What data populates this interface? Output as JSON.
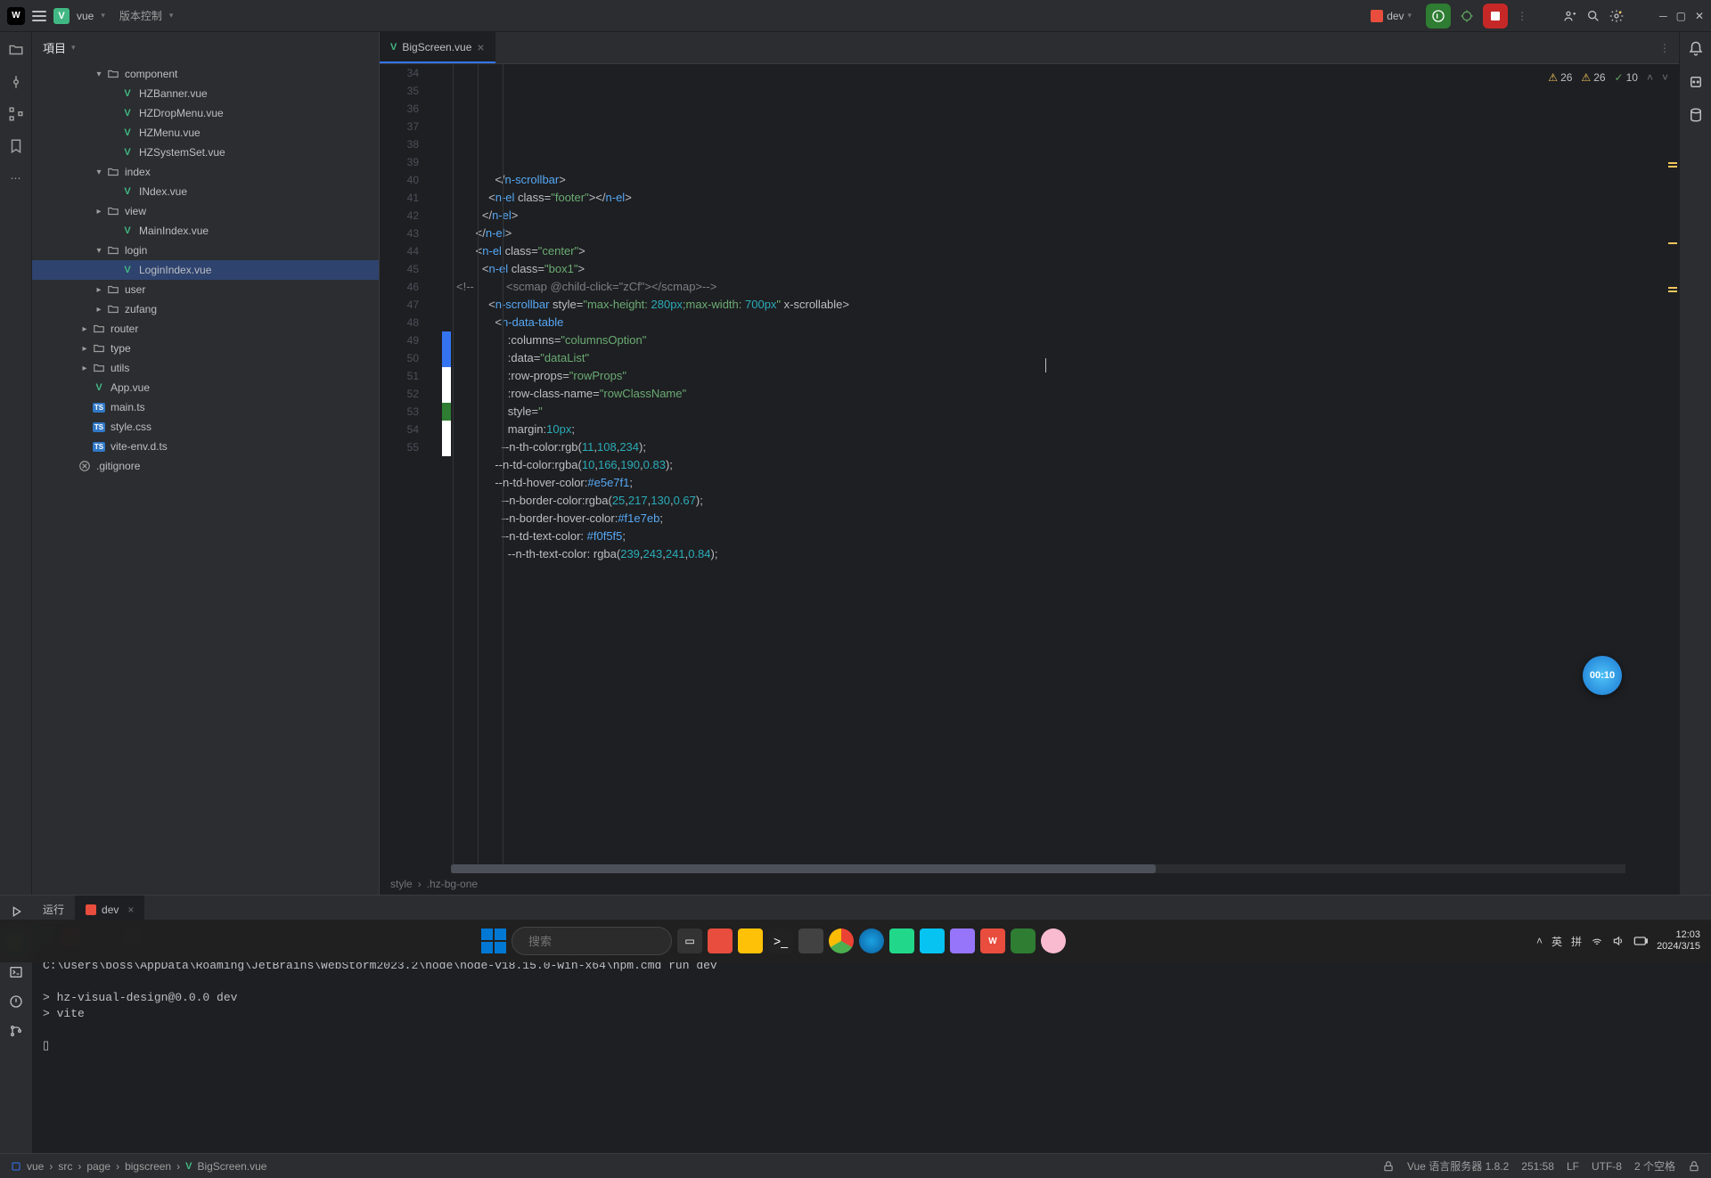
{
  "titlebar": {
    "project": "vue",
    "vcMenu": "版本控制",
    "runConfig": "dev"
  },
  "projectPanel": {
    "title": "項目"
  },
  "tree": [
    {
      "depth": 3,
      "arrow": "▾",
      "icon": "folder",
      "label": "component"
    },
    {
      "depth": 4,
      "arrow": "",
      "icon": "vue",
      "label": "HZBanner.vue"
    },
    {
      "depth": 4,
      "arrow": "",
      "icon": "vue",
      "label": "HZDropMenu.vue"
    },
    {
      "depth": 4,
      "arrow": "",
      "icon": "vue",
      "label": "HZMenu.vue"
    },
    {
      "depth": 4,
      "arrow": "",
      "icon": "vue",
      "label": "HZSystemSet.vue"
    },
    {
      "depth": 3,
      "arrow": "▾",
      "icon": "folder",
      "label": "index"
    },
    {
      "depth": 4,
      "arrow": "",
      "icon": "vue",
      "label": "INdex.vue"
    },
    {
      "depth": 3,
      "arrow": "▸",
      "icon": "folder",
      "label": "view"
    },
    {
      "depth": 4,
      "arrow": "",
      "icon": "vue",
      "label": "MainIndex.vue"
    },
    {
      "depth": 3,
      "arrow": "▾",
      "icon": "folder",
      "label": "login"
    },
    {
      "depth": 4,
      "arrow": "",
      "icon": "vue",
      "label": "LoginIndex.vue",
      "selected": true
    },
    {
      "depth": 3,
      "arrow": "▸",
      "icon": "folder",
      "label": "user"
    },
    {
      "depth": 3,
      "arrow": "▸",
      "icon": "folder",
      "label": "zufang"
    },
    {
      "depth": 2,
      "arrow": "▸",
      "icon": "folder",
      "label": "router"
    },
    {
      "depth": 2,
      "arrow": "▸",
      "icon": "folder",
      "label": "type"
    },
    {
      "depth": 2,
      "arrow": "▸",
      "icon": "folder",
      "label": "utils"
    },
    {
      "depth": 2,
      "arrow": "",
      "icon": "vue",
      "label": "App.vue"
    },
    {
      "depth": 2,
      "arrow": "",
      "icon": "ts",
      "label": "main.ts"
    },
    {
      "depth": 2,
      "arrow": "",
      "icon": "ts",
      "label": "style.css"
    },
    {
      "depth": 2,
      "arrow": "",
      "icon": "ts",
      "label": "vite-env.d.ts"
    },
    {
      "depth": 1,
      "arrow": "",
      "icon": "ignore",
      "label": ".gitignore"
    }
  ],
  "tab": {
    "label": "BigScreen.vue"
  },
  "problems": {
    "err": "26",
    "warn": "26",
    "typo": "10"
  },
  "lineStart": 34,
  "markers": {
    "49": "#3574f0",
    "50": "#3574f0",
    "51": "#ffffff",
    "52": "#ffffff",
    "53": "#2e7d32",
    "54": "#ffffff",
    "55": "#ffffff"
  },
  "code": [
    [
      {
        "t": "            </",
        "c": "c-punct"
      },
      {
        "t": "n-scrollbar",
        "c": "c-tag"
      },
      {
        "t": ">",
        "c": "c-punct"
      }
    ],
    [
      {
        "t": "          <",
        "c": "c-punct"
      },
      {
        "t": "n-el",
        "c": "c-tag"
      },
      {
        "t": " class",
        "c": "c-attr"
      },
      {
        "t": "=",
        "c": "c-punct"
      },
      {
        "t": "\"footer\"",
        "c": "c-str"
      },
      {
        "t": "></",
        "c": "c-punct"
      },
      {
        "t": "n-el",
        "c": "c-tag"
      },
      {
        "t": ">",
        "c": "c-punct"
      }
    ],
    [
      {
        "t": "        </",
        "c": "c-punct"
      },
      {
        "t": "n-el",
        "c": "c-tag"
      },
      {
        "t": ">",
        "c": "c-punct"
      }
    ],
    [
      {
        "t": "      </",
        "c": "c-punct"
      },
      {
        "t": "n-el",
        "c": "c-tag"
      },
      {
        "t": ">",
        "c": "c-punct"
      }
    ],
    [
      {
        "t": "      <",
        "c": "c-punct"
      },
      {
        "t": "n-el",
        "c": "c-tag"
      },
      {
        "t": " class",
        "c": "c-attr"
      },
      {
        "t": "=",
        "c": "c-punct"
      },
      {
        "t": "\"center\"",
        "c": "c-str"
      },
      {
        "t": ">",
        "c": "c-punct"
      }
    ],
    [
      {
        "t": "        <",
        "c": "c-punct"
      },
      {
        "t": "n-el",
        "c": "c-tag"
      },
      {
        "t": " class",
        "c": "c-attr"
      },
      {
        "t": "=",
        "c": "c-punct"
      },
      {
        "t": "\"box1\"",
        "c": "c-str"
      },
      {
        "t": ">",
        "c": "c-punct"
      }
    ],
    [
      {
        "t": "<!--",
        "c": "c-cmt"
      },
      {
        "t": "          <scmap @child-click=\"zCf\"></scmap>",
        "c": "c-cmt"
      },
      {
        "t": "-->",
        "c": "c-cmt"
      }
    ],
    [
      {
        "t": "          <",
        "c": "c-punct"
      },
      {
        "t": "n-scrollbar",
        "c": "c-tag"
      },
      {
        "t": " style",
        "c": "c-attr"
      },
      {
        "t": "=",
        "c": "c-punct"
      },
      {
        "t": "\"max-height: ",
        "c": "c-str"
      },
      {
        "t": "280px",
        "c": "c-num"
      },
      {
        "t": ";max-width: ",
        "c": "c-str"
      },
      {
        "t": "700px",
        "c": "c-num"
      },
      {
        "t": "\"",
        "c": "c-str"
      },
      {
        "t": " x-scrollable",
        "c": "c-attr"
      },
      {
        "t": ">",
        "c": "c-punct"
      }
    ],
    [
      {
        "t": "            <",
        "c": "c-punct"
      },
      {
        "t": "n-data-table",
        "c": "c-tag"
      }
    ],
    [
      {
        "t": "                :columns",
        "c": "c-attr"
      },
      {
        "t": "=",
        "c": "c-punct"
      },
      {
        "t": "\"columnsOption\"",
        "c": "c-str"
      }
    ],
    [
      {
        "t": "                :data",
        "c": "c-attr"
      },
      {
        "t": "=",
        "c": "c-punct"
      },
      {
        "t": "\"dataList\"",
        "c": "c-str"
      }
    ],
    [
      {
        "t": "                :row-props",
        "c": "c-attr"
      },
      {
        "t": "=",
        "c": "c-punct"
      },
      {
        "t": "\"rowProps\"",
        "c": "c-str"
      }
    ],
    [
      {
        "t": "                :row-class-name",
        "c": "c-attr"
      },
      {
        "t": "=",
        "c": "c-punct"
      },
      {
        "t": "\"rowClassName\"",
        "c": "c-str"
      }
    ],
    [
      {
        "t": "                style",
        "c": "c-attr"
      },
      {
        "t": "=",
        "c": "c-punct"
      },
      {
        "t": "\"",
        "c": "c-str"
      }
    ],
    [
      {
        "t": "                margin:",
        "c": "c-attr"
      },
      {
        "t": "10px",
        "c": "c-num"
      },
      {
        "t": ";",
        "c": "c-punct"
      }
    ],
    [
      {
        "t": "              --n-th-color:rgb(",
        "c": "c-attr"
      },
      {
        "t": "11",
        "c": "c-num"
      },
      {
        "t": ",",
        "c": "c-punct"
      },
      {
        "t": "108",
        "c": "c-num"
      },
      {
        "t": ",",
        "c": "c-punct"
      },
      {
        "t": "234",
        "c": "c-num"
      },
      {
        "t": ");",
        "c": "c-punct"
      }
    ],
    [
      {
        "t": "            --n-td-color:rgba(",
        "c": "c-attr"
      },
      {
        "t": "10",
        "c": "c-num"
      },
      {
        "t": ",",
        "c": "c-punct"
      },
      {
        "t": "166",
        "c": "c-num"
      },
      {
        "t": ",",
        "c": "c-punct"
      },
      {
        "t": "190",
        "c": "c-num"
      },
      {
        "t": ",",
        "c": "c-punct"
      },
      {
        "t": "0.83",
        "c": "c-num"
      },
      {
        "t": ");",
        "c": "c-punct"
      }
    ],
    [
      {
        "t": "            --n-td-hover-color:",
        "c": "c-attr"
      },
      {
        "t": "#e5e7f1",
        "c": "c-hex"
      },
      {
        "t": ";",
        "c": "c-punct"
      }
    ],
    [
      {
        "t": "              --n-border-color:rgba(",
        "c": "c-attr"
      },
      {
        "t": "25",
        "c": "c-num"
      },
      {
        "t": ",",
        "c": "c-punct"
      },
      {
        "t": "217",
        "c": "c-num"
      },
      {
        "t": ",",
        "c": "c-punct"
      },
      {
        "t": "130",
        "c": "c-num"
      },
      {
        "t": ",",
        "c": "c-punct"
      },
      {
        "t": "0.67",
        "c": "c-num"
      },
      {
        "t": ");",
        "c": "c-punct"
      }
    ],
    [
      {
        "t": "              --n-border-hover-color:",
        "c": "c-attr"
      },
      {
        "t": "#f1e7eb",
        "c": "c-hex"
      },
      {
        "t": ";",
        "c": "c-punct"
      }
    ],
    [
      {
        "t": "              --n-td-text-color: ",
        "c": "c-attr"
      },
      {
        "t": "#f0f5f5",
        "c": "c-hex"
      },
      {
        "t": ";",
        "c": "c-punct"
      }
    ],
    [
      {
        "t": "                --n-th-text-color: rgba(",
        "c": "c-attr"
      },
      {
        "t": "239",
        "c": "c-num"
      },
      {
        "t": ",",
        "c": "c-punct"
      },
      {
        "t": "243",
        "c": "c-num"
      },
      {
        "t": ",",
        "c": "c-punct"
      },
      {
        "t": "241",
        "c": "c-num"
      },
      {
        "t": ",",
        "c": "c-punct"
      },
      {
        "t": "0.84",
        "c": "c-num"
      },
      {
        "t": ");",
        "c": "c-punct"
      }
    ]
  ],
  "breadcrumb": [
    "style",
    ".hz-bg-one"
  ],
  "bottomTabs": {
    "run": "运行",
    "dev": "dev"
  },
  "terminal": [
    "C:\\Users\\boss\\AppData\\Roaming\\JetBrains\\WebStorm2023.2\\node\\node-v18.15.0-win-x64\\npm.cmd run dev",
    "",
    "> hz-visual-design@0.0.0 dev",
    "> vite",
    "",
    "▯"
  ],
  "statusPath": [
    "vue",
    "src",
    "page",
    "bigscreen",
    "BigScreen.vue"
  ],
  "statusRight": {
    "vueService": "Vue 语言服务器 1.8.2",
    "pos": "251:58",
    "eol": "LF",
    "enc": "UTF-8",
    "indent": "2 个空格"
  },
  "recordBadge": "00:10",
  "taskbar": {
    "searchPlaceholder": "搜索",
    "ime1": "英",
    "ime2": "拼",
    "time": "12:03",
    "date": "2024/3/15"
  }
}
